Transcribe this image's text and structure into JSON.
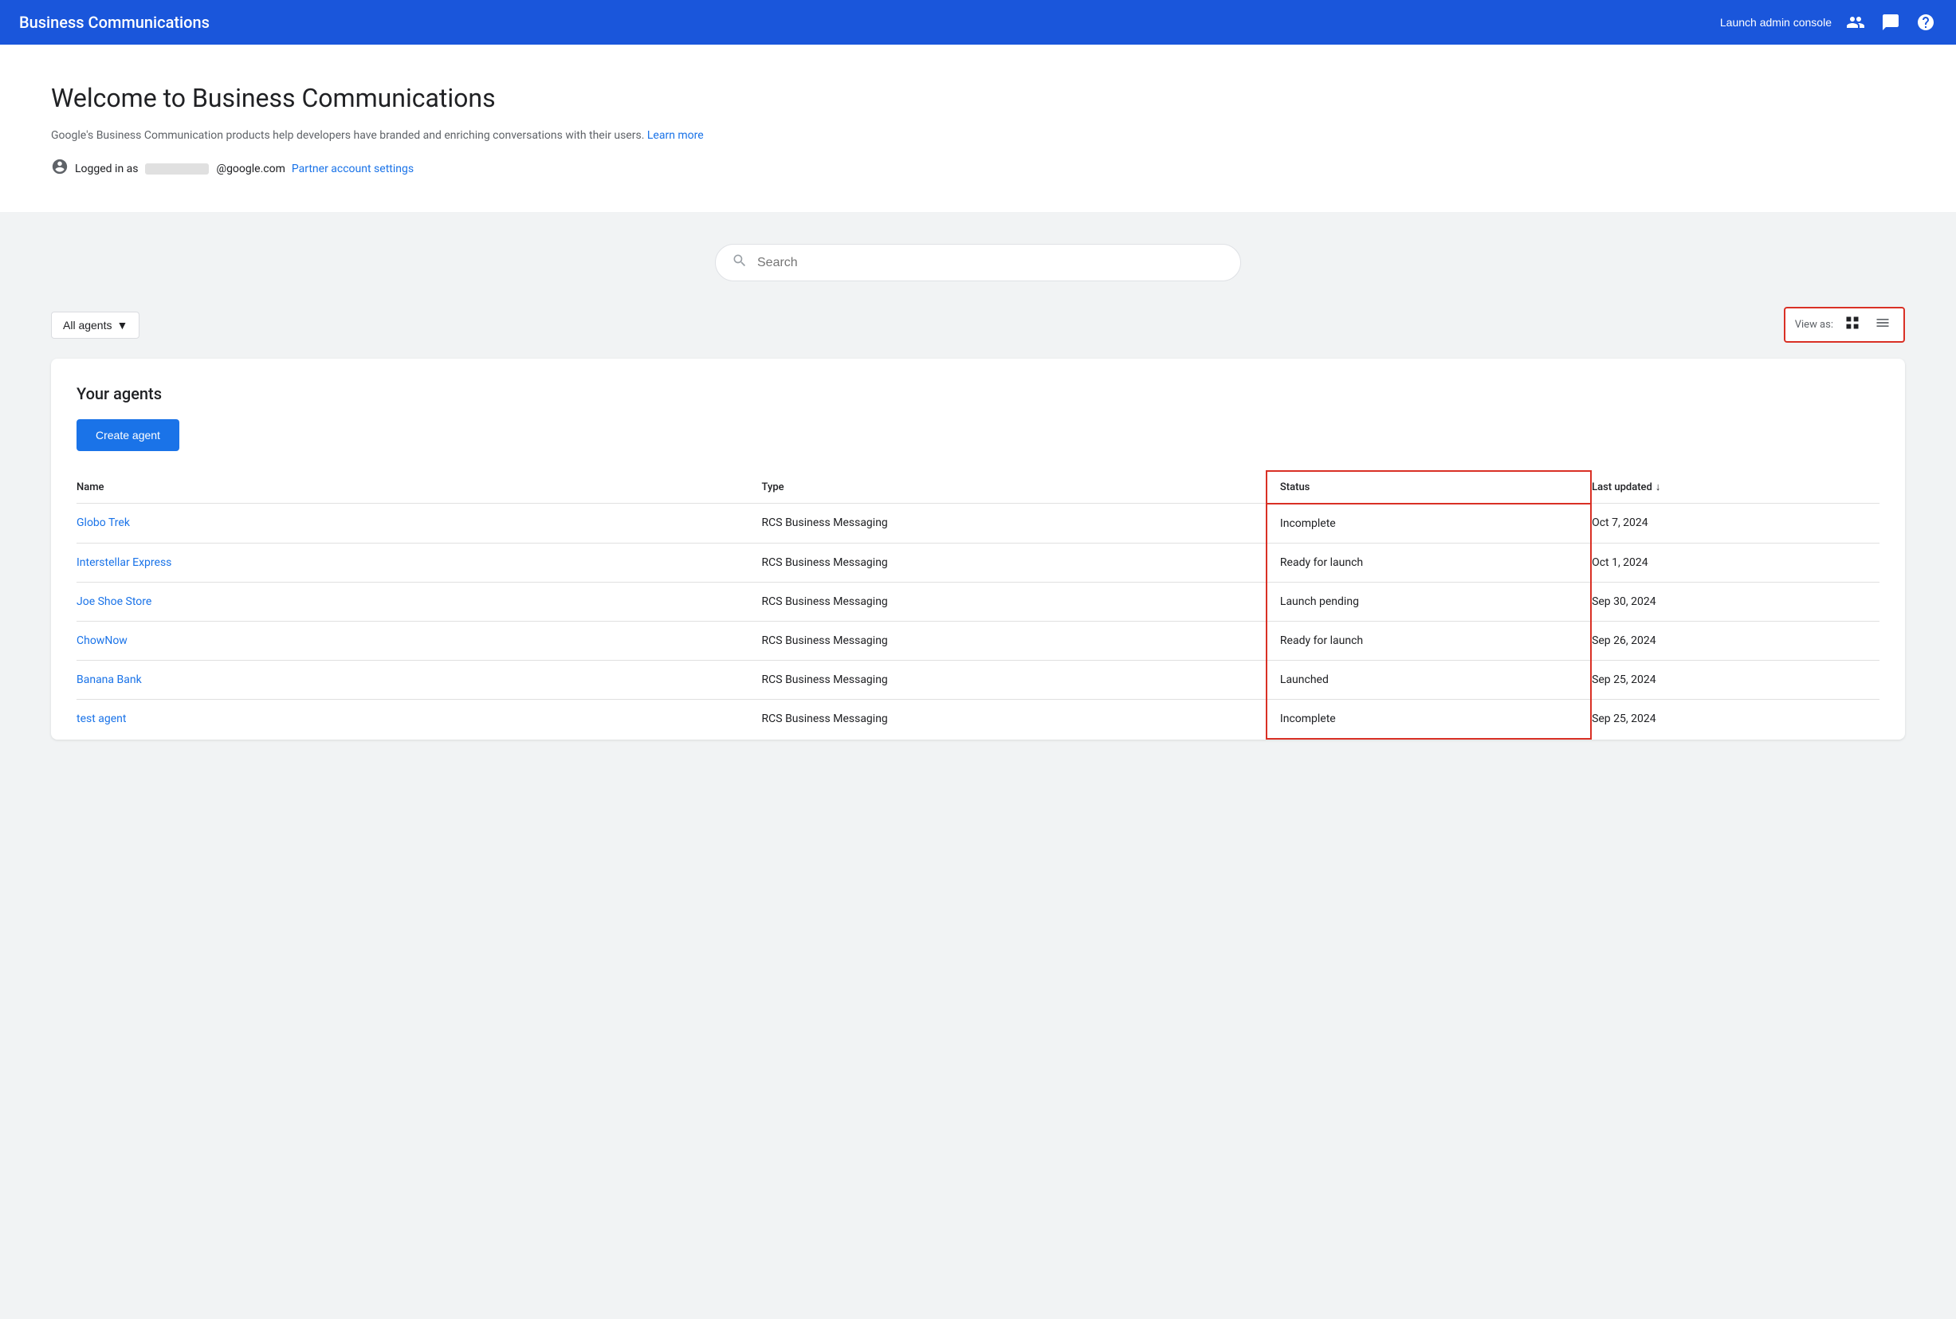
{
  "header": {
    "title": "Business Communications",
    "launch_btn": "Launch admin console"
  },
  "welcome": {
    "title": "Welcome to Business Communications",
    "description": "Google's Business Communication products help developers have branded and enriching conversations with their users.",
    "learn_more": "Learn more",
    "logged_in_prefix": "Logged in as",
    "email_domain": "@google.com",
    "partner_link": "Partner account settings"
  },
  "search": {
    "placeholder": "Search"
  },
  "filters": {
    "all_agents": "All agents"
  },
  "view_as": {
    "label": "View as:"
  },
  "agents_section": {
    "title": "Your agents",
    "create_btn": "Create agent",
    "table": {
      "columns": [
        "Name",
        "Type",
        "Status",
        "Last updated"
      ],
      "rows": [
        {
          "name": "Globo Trek",
          "type": "RCS Business Messaging",
          "status": "Incomplete",
          "last_updated": "Oct 7, 2024"
        },
        {
          "name": "Interstellar Express",
          "type": "RCS Business Messaging",
          "status": "Ready for launch",
          "last_updated": "Oct 1, 2024"
        },
        {
          "name": "Joe Shoe Store",
          "type": "RCS Business Messaging",
          "status": "Launch pending",
          "last_updated": "Sep 30, 2024"
        },
        {
          "name": "ChowNow",
          "type": "RCS Business Messaging",
          "status": "Ready for launch",
          "last_updated": "Sep 26, 2024"
        },
        {
          "name": "Banana Bank",
          "type": "RCS Business Messaging",
          "status": "Launched",
          "last_updated": "Sep 25, 2024"
        },
        {
          "name": "test agent",
          "type": "RCS Business Messaging",
          "status": "Incomplete",
          "last_updated": "Sep 25, 2024"
        }
      ]
    }
  }
}
